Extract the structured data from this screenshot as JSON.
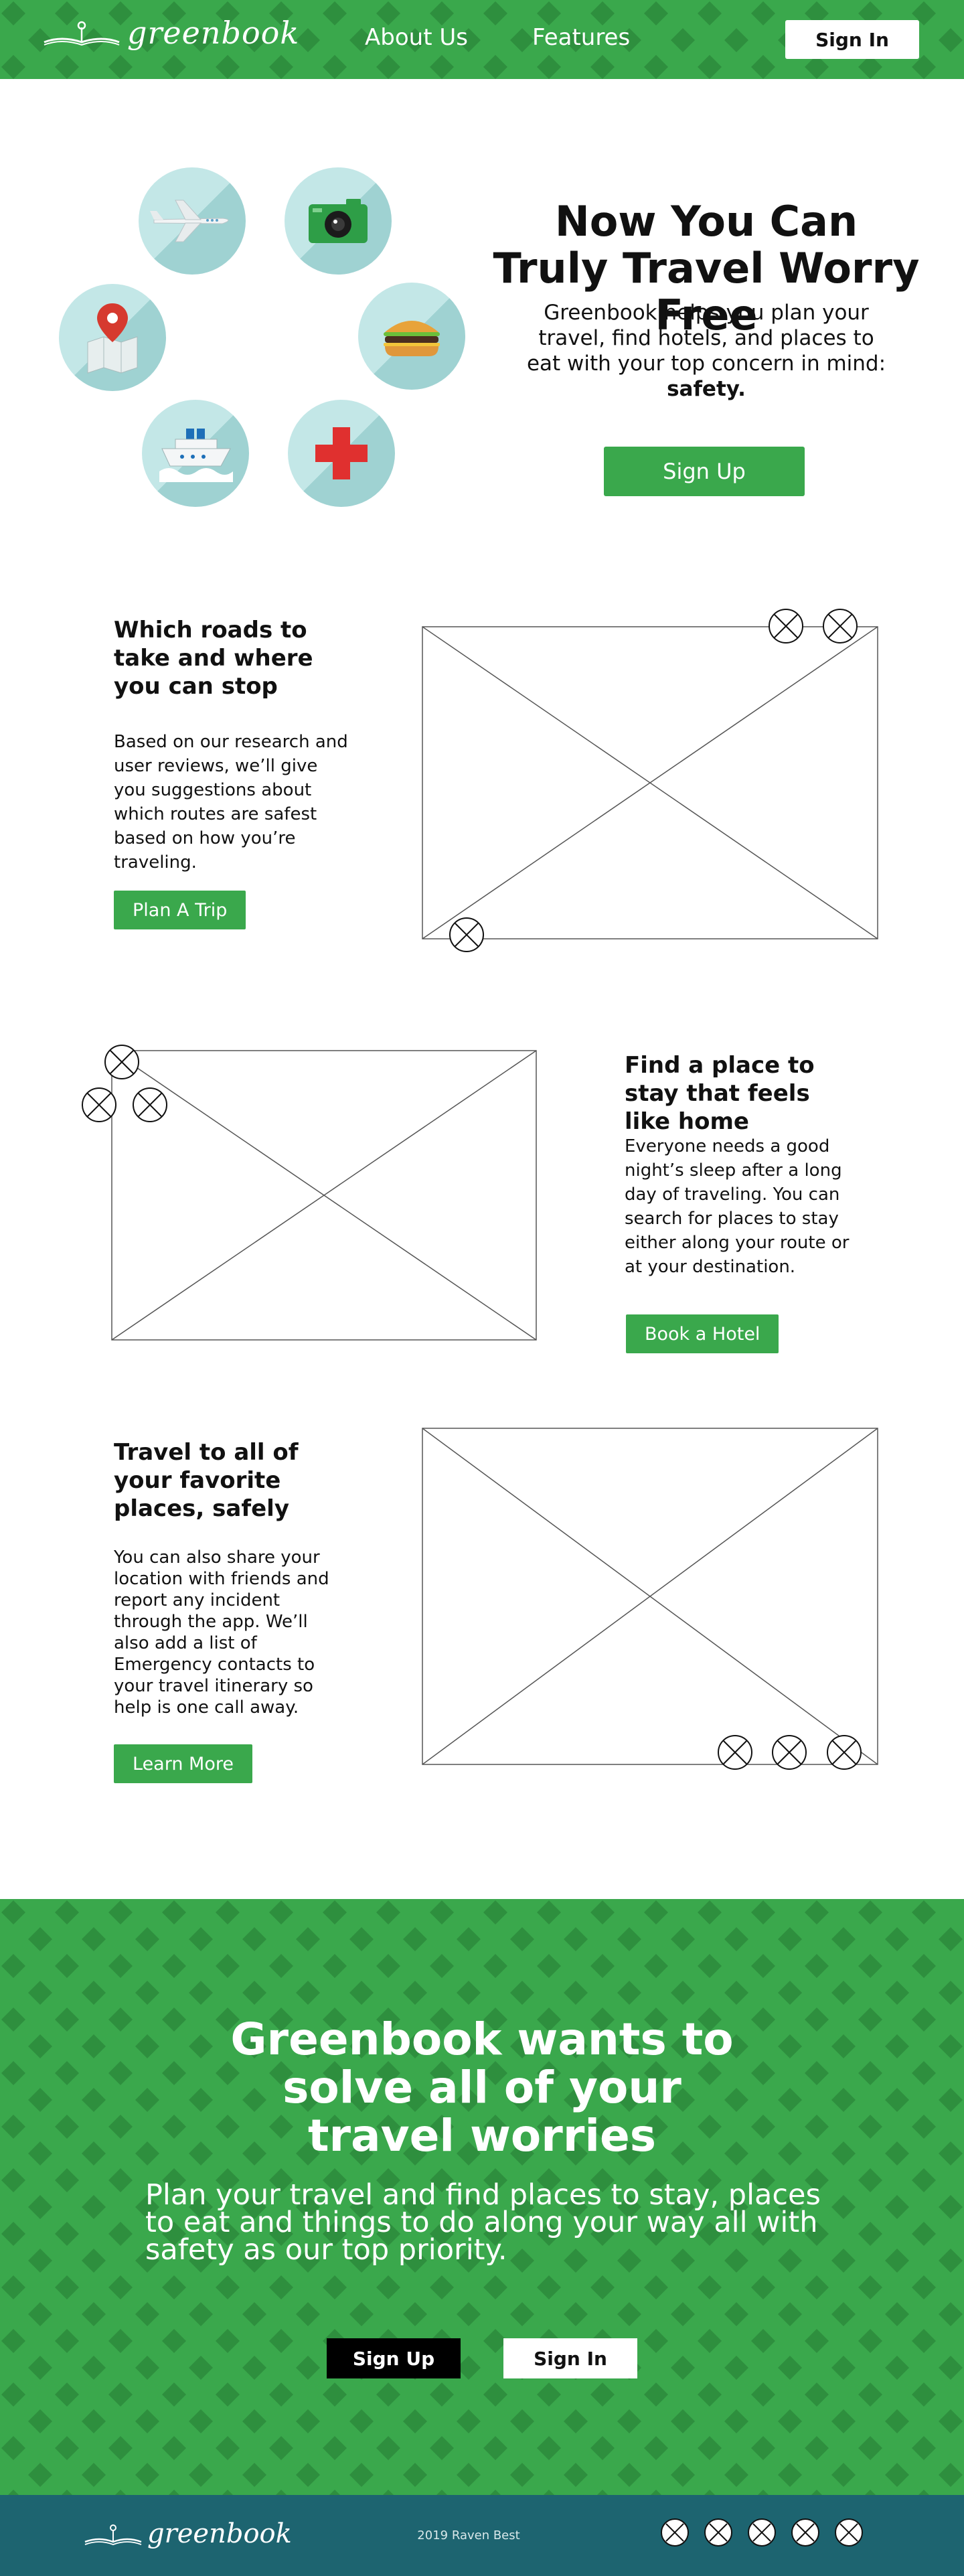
{
  "header": {
    "logo_text": "greenbook",
    "nav": [
      "About Us",
      "Features"
    ],
    "signin_label": "Sign In"
  },
  "hero": {
    "icons": [
      "airplane-icon",
      "camera-icon",
      "map-pin-icon",
      "burger-icon",
      "ship-icon",
      "medical-cross-icon"
    ],
    "title": "Now You Can Truly Travel Worry Free",
    "subtitle_main": "Greenbook helps you plan your travel, find hotels, and places to eat with your top concern in mind: ",
    "subtitle_bold": "safety.",
    "signup_label": "Sign Up"
  },
  "features": [
    {
      "title": "Which roads to take and where you can stop",
      "body": "Based on our research and user reviews, we’ll give you suggestions about which routes are safest based on how you’re traveling.",
      "button": "Plan A Trip"
    },
    {
      "title": "Find a place to stay that feels like home",
      "body": "Everyone needs a good night’s sleep after a long day of traveling. You can search for places to stay either along your route or at your destination.",
      "button": "Book a Hotel"
    },
    {
      "title": "Travel to all of your favorite places, safely",
      "body": "You can also share your location with friends and report any incident through the app. We’ll also add a list of Emergency contacts to your travel itinerary so help is one call away.",
      "button": "Learn More"
    }
  ],
  "cta": {
    "title": "Greenbook wants to solve all of your travel worries",
    "subtitle": "Plan your travel and find places to stay, places to eat and things to do along your way all with safety as our top priority.",
    "signup_label": "Sign Up",
    "signin_label": "Sign In"
  },
  "footer": {
    "logo_text": "greenbook",
    "copyright": "2019 Raven Best",
    "social_icons": [
      "social-icon-1",
      "social-icon-2",
      "social-icon-3",
      "social-icon-4",
      "social-icon-5"
    ]
  },
  "colors": {
    "brand_green": "#3aa84c",
    "footer_teal": "#1d6470",
    "circle_light": "#c3e7e7"
  }
}
